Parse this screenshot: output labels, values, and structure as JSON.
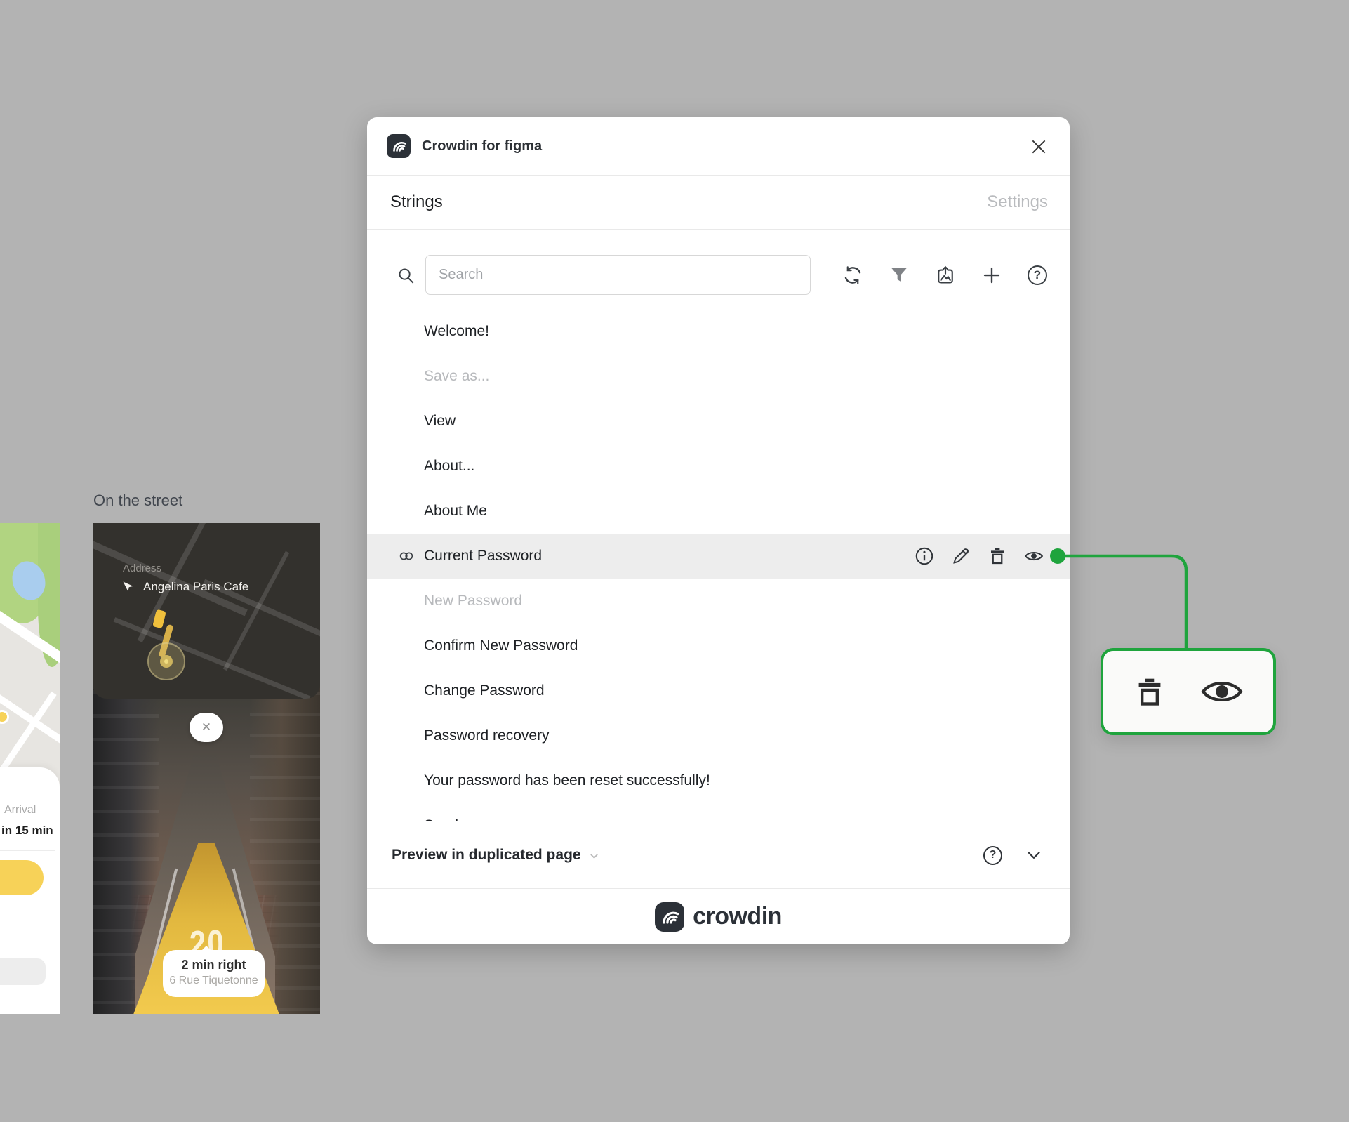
{
  "plugin": {
    "title": "Crowdin for figma",
    "tabs": {
      "strings": "Strings",
      "settings": "Settings"
    },
    "toolbar": {
      "search_placeholder": "Search",
      "icons": [
        "sync",
        "filter",
        "export-image",
        "add",
        "help"
      ]
    },
    "strings": [
      {
        "label": "Welcome!",
        "state": "normal"
      },
      {
        "label": "Save as...",
        "state": "muted"
      },
      {
        "label": "View",
        "state": "normal"
      },
      {
        "label": "About...",
        "state": "normal"
      },
      {
        "label": "About Me",
        "state": "normal"
      },
      {
        "label": "Current Password",
        "state": "selected"
      },
      {
        "label": "New Password",
        "state": "muted"
      },
      {
        "label": "Confirm New Password",
        "state": "normal"
      },
      {
        "label": "Change Password",
        "state": "normal"
      },
      {
        "label": "Password recovery",
        "state": "normal"
      },
      {
        "label": "Your password has been reset successfully!",
        "state": "normal"
      },
      {
        "label": "Send",
        "state": "clipped"
      }
    ],
    "selected_row_actions": [
      "info",
      "edit",
      "delete",
      "toggle-visibility"
    ],
    "footer": {
      "preview_label": "Preview in duplicated page"
    },
    "brand_wordmark": "crowdin"
  },
  "actions_popup": {
    "icons": [
      "delete",
      "toggle-visibility"
    ]
  },
  "canvas_frames": {
    "street_frame_label": "On the street",
    "ar_navigation": {
      "address_label": "Address",
      "address_value": "Angelina Paris Cafe",
      "path_marking": "20",
      "close_glyph": "✕",
      "direction_title": "2 min right",
      "direction_subtitle": "6 Rue Tiquetonne"
    },
    "ride_panel": {
      "arrival_label": "Arrival",
      "arrival_value": "in 15 min"
    }
  },
  "colors": {
    "accent_green": "#1fa43d",
    "selected_row_bg": "#ededed",
    "taxi_yellow": "#f7d258",
    "canvas_bg": "#b3b3b3"
  }
}
